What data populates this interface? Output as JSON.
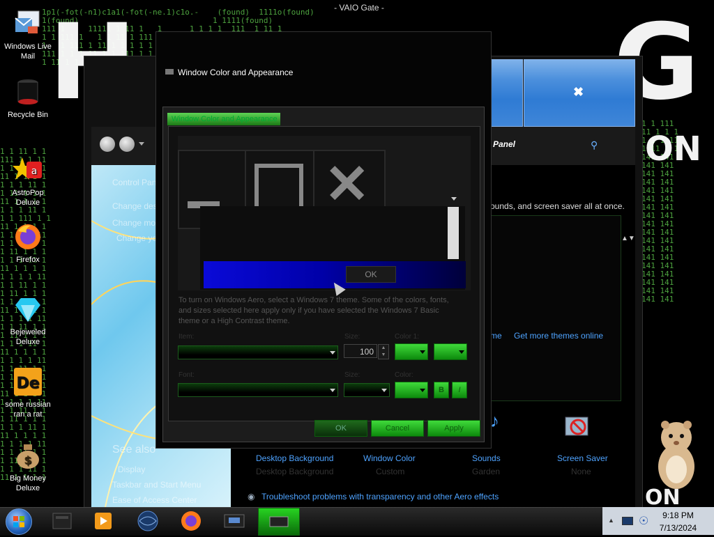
{
  "desktop_caption": "- VAIO Gate -",
  "desktop_icons": [
    {
      "label": "Windows Live Mail",
      "icon": "mail-icon"
    },
    {
      "label": "Recycle Bin",
      "icon": "recycle-bin-icon"
    },
    {
      "label": "AstroPop Deluxe",
      "icon": "astropop-icon"
    },
    {
      "label": "Firefox",
      "icon": "firefox-icon"
    },
    {
      "label": "Bejeweled Deluxe",
      "icon": "bejeweled-icon"
    },
    {
      "label": "some russian ran a rat",
      "icon": "de-app-icon"
    },
    {
      "label": "Big Money Deluxe",
      "icon": "money-bag-icon"
    }
  ],
  "control_panel": {
    "address": "ol Panel",
    "sidebar_links": [
      "Control Panel Home",
      "Change desktop icons",
      "Change mouse pointers",
      "Change your account picture"
    ],
    "intro_text": "ounds, and screen saver all at once.",
    "get_more_link": "Get more themes online",
    "partial_link": "me",
    "see_also_title": "See also",
    "see_also_links": [
      "Display",
      "Taskbar and Start Menu",
      "Ease of Access Center"
    ],
    "bottom_items": [
      {
        "label": "Desktop Background",
        "sub": "Desktop Background"
      },
      {
        "label": "Window Color",
        "sub": "Custom"
      },
      {
        "label": "Sounds",
        "sub": "Garden"
      },
      {
        "label": "Screen Saver",
        "sub": "None"
      }
    ],
    "troubleshoot_link": "Troubleshoot problems with transparency and other Aero effects"
  },
  "dialog": {
    "title": "Window Color and Appearance",
    "tab_label": "Window Color and Appearance",
    "ok_mini": "OK",
    "description": "To turn on Windows Aero, select a Windows 7 theme. Some of the colors, fonts, and sizes selected here apply only if you have selected the Windows 7 Basic theme or a High Contrast theme.",
    "item_label": "Item:",
    "size_label": "Size:",
    "size_value": "100",
    "color1_label": "Color 1:",
    "font_label": "Font:",
    "font_size_label": "Size:",
    "font_color_label": "Color:",
    "bold_label": "B",
    "italic_label": "I",
    "ok_button": "OK",
    "cancel_button": "Cancel",
    "apply_button": "Apply"
  },
  "taskbar": {
    "items": [
      "start-orb",
      "explorer-icon",
      "media-player-icon",
      "globe-icon",
      "firefox-icon",
      "control-panel-icon",
      "vaio-gate-icon"
    ],
    "time": "9:18 PM",
    "date": "7/13/2024"
  },
  "colors": {
    "accent_green": "#3fda3a",
    "link_blue": "#4ea3ff",
    "matrix_green": "#5bbf4a"
  }
}
